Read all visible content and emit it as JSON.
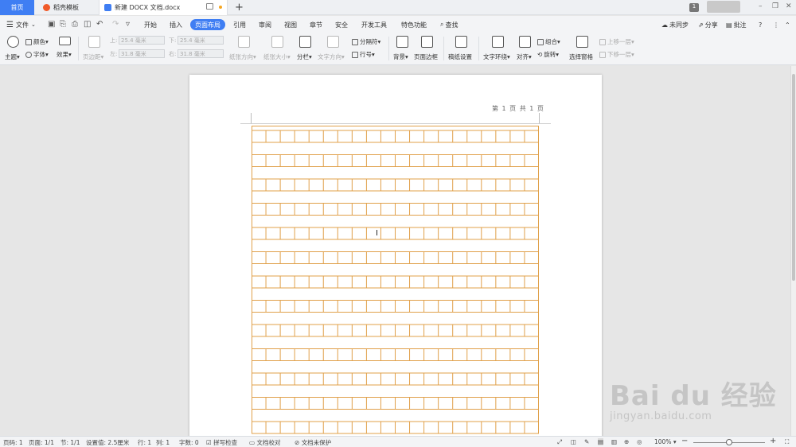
{
  "tabs": {
    "home": "首页",
    "template": "稻壳模板",
    "document": "新建 DOCX 文档.docx",
    "new_tab": "+"
  },
  "topbar": {
    "badge": "1"
  },
  "menu": {
    "file": "文件",
    "items": [
      "开始",
      "插入",
      "页面布局",
      "引用",
      "审阅",
      "视图",
      "章节",
      "安全",
      "开发工具",
      "特色功能"
    ],
    "active_index": 2,
    "search": "查找",
    "right": {
      "sync": "未同步",
      "share": "分享",
      "comment": "批注"
    }
  },
  "ribbon": {
    "theme": "主题",
    "color": "颜色",
    "font": "字体",
    "effect": "效果",
    "margins": "页边距",
    "top_label": "上:",
    "top_value": "25.4 毫米",
    "bottom_label": "下:",
    "bottom_value": "25.4 毫米",
    "left_label": "左:",
    "left_value": "31.8 毫米",
    "right_label": "右:",
    "right_value": "31.8 毫米",
    "orientation": "纸张方向",
    "size": "纸张大小",
    "columns": "分栏",
    "text_direction": "文字方向",
    "separator": "分隔符",
    "line_number": "行号",
    "background": "背景",
    "page_border": "页面边框",
    "grid_paper": "稿纸设置",
    "text_wrap": "文字环绕",
    "align": "对齐",
    "rotate": "旋转",
    "group": "组合",
    "selection_pane": "选择窗格",
    "bring_forward": "上移一层",
    "send_backward": "下移一层"
  },
  "document": {
    "header_text": "第 1 页 共 1 页",
    "grid_color": "#e0a04a",
    "grid_columns": 20,
    "grid_rows": 13
  },
  "status": {
    "page_code": "页码: 1",
    "page": "页面: 1/1",
    "section": "节: 1/1",
    "setting": "设置值: 2.5厘米",
    "row": "行: 1",
    "col": "列: 1",
    "word_count": "字数: 0",
    "spell_check": "拼写检查",
    "doc_compare": "文档校对",
    "protect": "文档未保护",
    "zoom": "100%"
  },
  "watermark": {
    "main": "Bai du 经验",
    "sub": "jingyan.baidu.com"
  },
  "colors": {
    "accent": "#3f7ef3",
    "grid": "#e0a04a"
  }
}
